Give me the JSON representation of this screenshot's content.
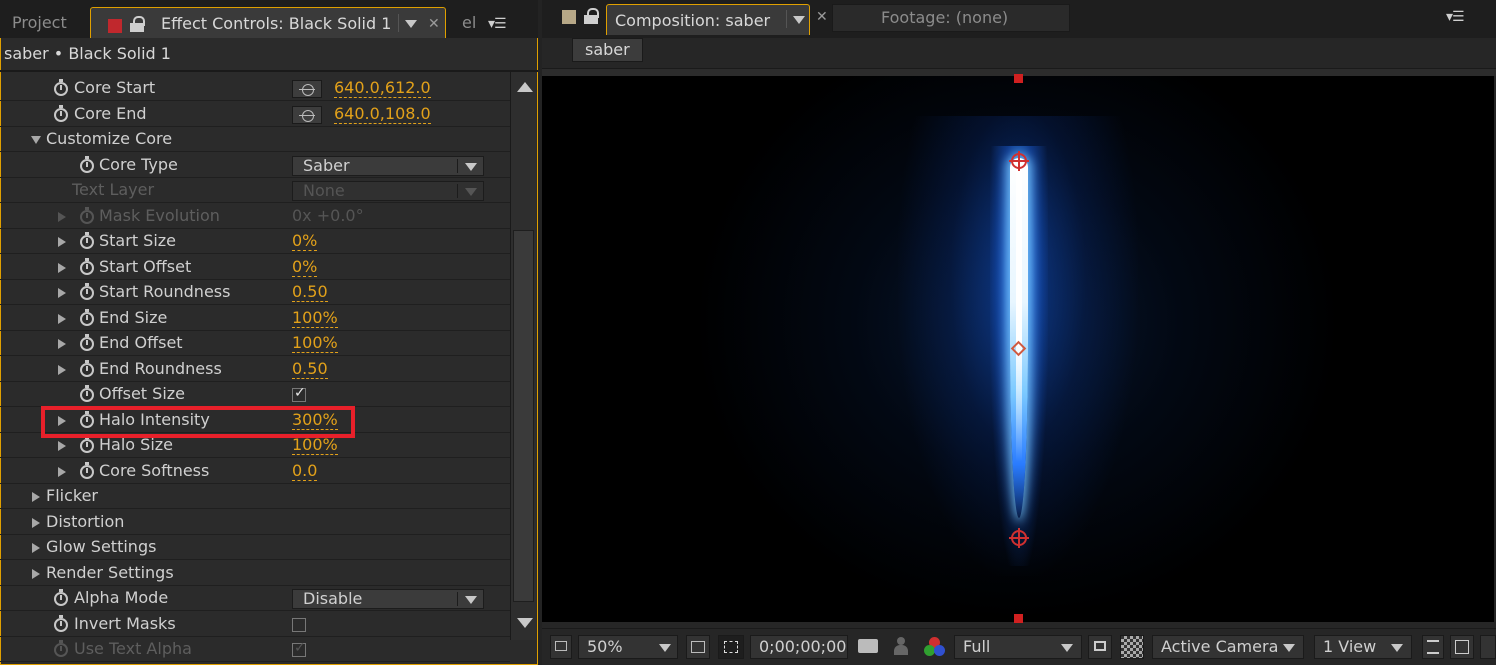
{
  "left_panel": {
    "tabs": {
      "project": "Project",
      "effect_controls": "Effect Controls: Black Solid 1",
      "third_partial": "el"
    },
    "layer_header": "saber • Black Solid 1",
    "rows": [
      {
        "label": "Core Start",
        "value": "640.0,612.0"
      },
      {
        "label": "Core End",
        "value": "640.0,108.0"
      },
      {
        "label": "Customize Core"
      },
      {
        "label": "Core Type",
        "value": "Saber"
      },
      {
        "label": "Text Layer",
        "value": "None"
      },
      {
        "label": "Mask Evolution",
        "value": "0x +0.0°"
      },
      {
        "label": "Start Size",
        "value": "0%"
      },
      {
        "label": "Start Offset",
        "value": "0%"
      },
      {
        "label": "Start Roundness",
        "value": "0.50"
      },
      {
        "label": "End Size",
        "value": "100%"
      },
      {
        "label": "End Offset",
        "value": "100%"
      },
      {
        "label": "End Roundness",
        "value": "0.50"
      },
      {
        "label": "Offset Size",
        "checked": true
      },
      {
        "label": "Halo Intensity",
        "value": "300%"
      },
      {
        "label": "Halo Size",
        "value": "100%"
      },
      {
        "label": "Core Softness",
        "value": "0.0"
      },
      {
        "label": "Flicker"
      },
      {
        "label": "Distortion"
      },
      {
        "label": "Glow Settings"
      },
      {
        "label": "Render Settings"
      },
      {
        "label": "Alpha Mode",
        "value": "Disable"
      },
      {
        "label": "Invert Masks",
        "checked": false
      },
      {
        "label": "Use Text Alpha",
        "checked": true
      }
    ]
  },
  "right_panel": {
    "tabs": {
      "composition": "Composition: saber",
      "footage": "Footage: (none)"
    },
    "comp_subtab": "saber",
    "bottom_bar": {
      "zoom": "50%",
      "timecode": "0;00;00;00",
      "resolution": "Full",
      "camera": "Active Camera",
      "views": "1 View"
    }
  },
  "colors": {
    "accent_value": "#e2a11a",
    "panel_active_border": "#e0a000",
    "highlight_box": "#e8202a",
    "saber_glow": "#2a7cff"
  },
  "icons": [
    "stopwatch-icon",
    "lock-icon",
    "close-icon",
    "panel-menu-icon",
    "target-icon",
    "snapshot-icon",
    "channel-icon"
  ]
}
